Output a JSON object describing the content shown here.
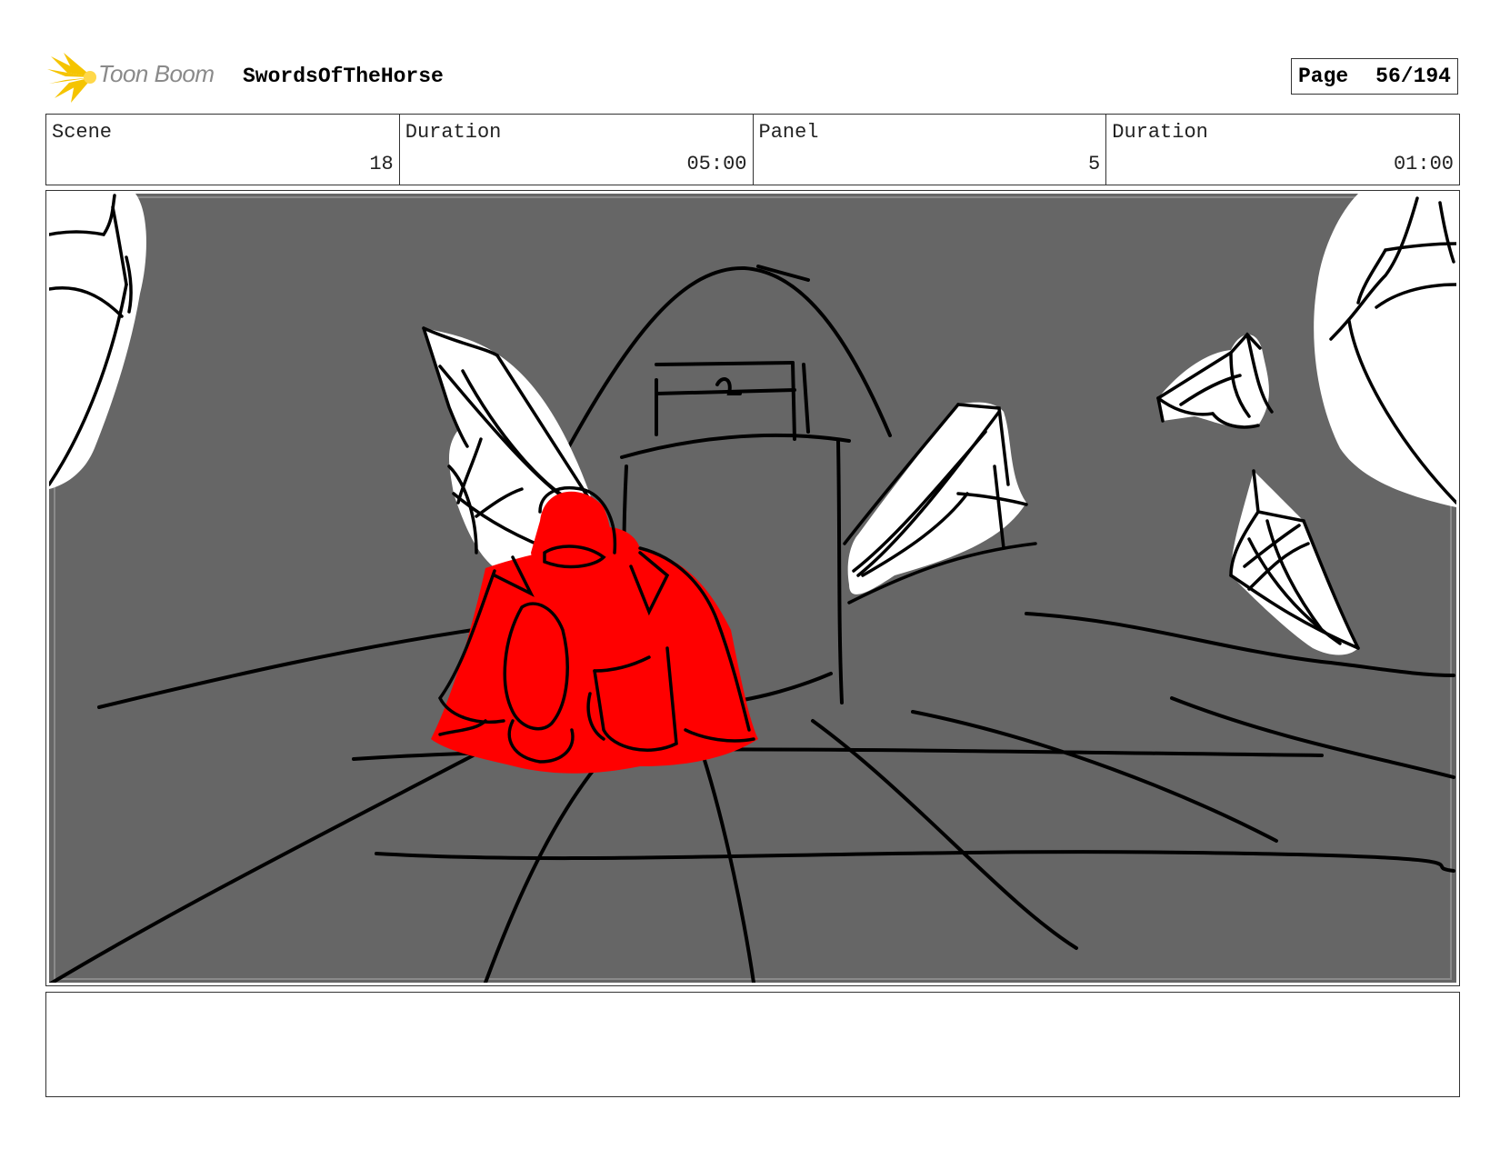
{
  "header": {
    "logo_text": "Toon Boom",
    "project_title": "SwordsOfTheHorse",
    "page_label": "Page",
    "page_number": "56/194"
  },
  "info": {
    "scene_label": "Scene",
    "scene_value": "18",
    "scene_duration_label": "Duration",
    "scene_duration_value": "05:00",
    "panel_label": "Panel",
    "panel_value": "5",
    "panel_duration_label": "Duration",
    "panel_duration_value": "01:00"
  },
  "colors": {
    "background_gray": "#666666",
    "character_red": "#ff0000",
    "logo_yellow": "#f5c400"
  }
}
